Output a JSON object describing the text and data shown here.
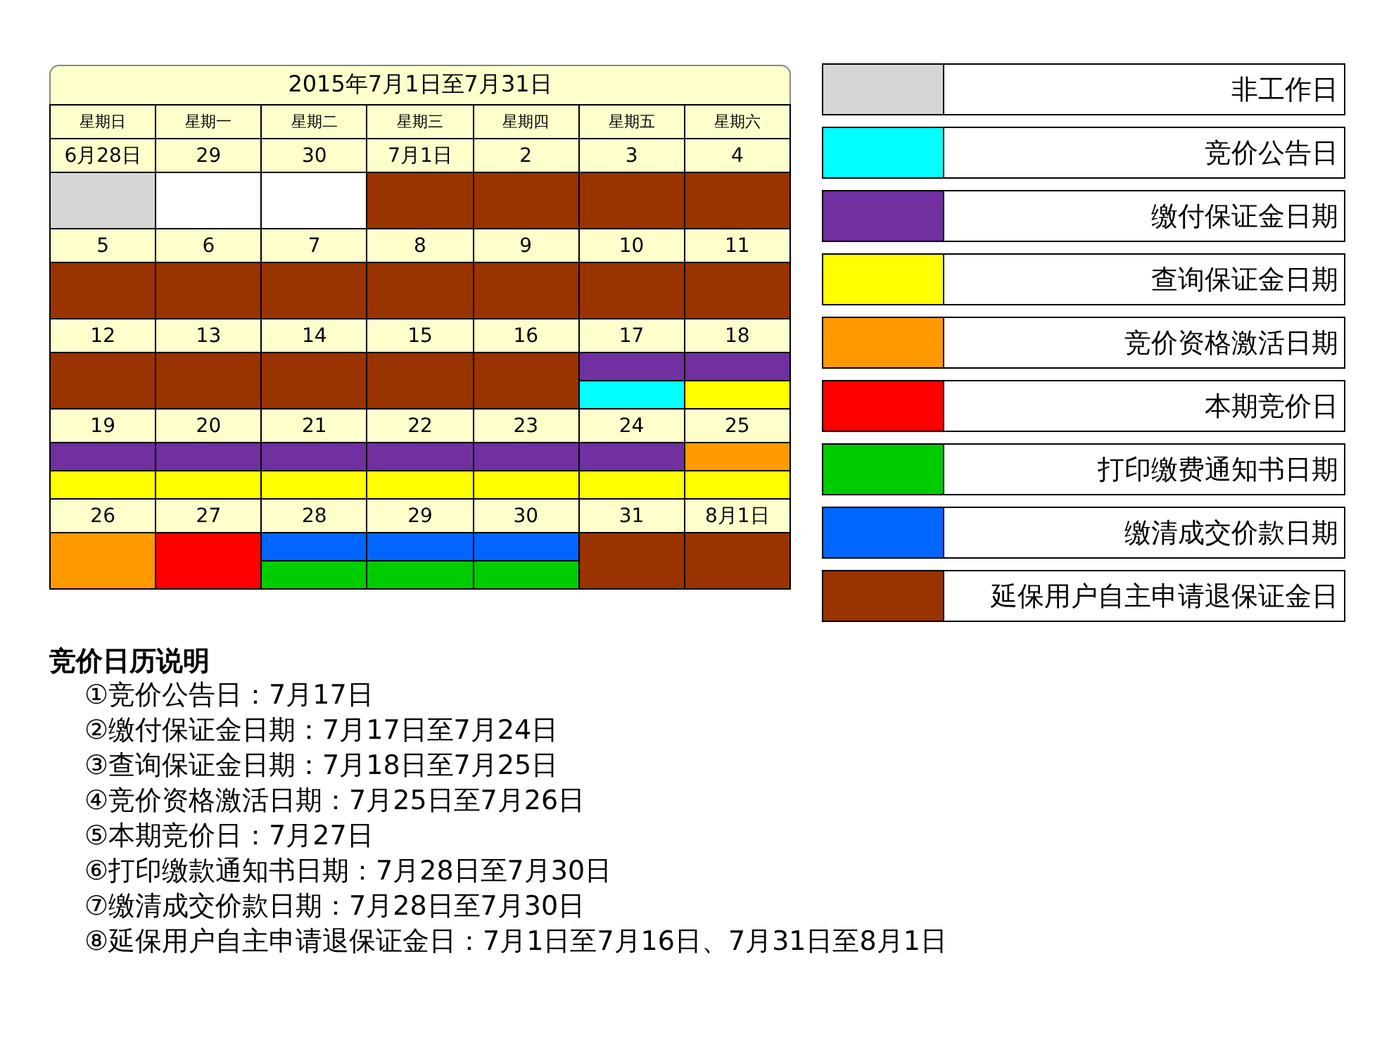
{
  "calendar": {
    "title": "2015年7月1日至7月31日",
    "weekdays": [
      "星期日",
      "星期一",
      "星期二",
      "星期三",
      "星期四",
      "星期五",
      "星期六"
    ],
    "weeks": [
      {
        "days": [
          {
            "label": "6月28日",
            "bands": [
              {
                "color": "#d6d6d6"
              }
            ]
          },
          {
            "label": "29",
            "bands": [
              {
                "color": "#ffffff"
              }
            ]
          },
          {
            "label": "30",
            "bands": [
              {
                "color": "#ffffff"
              }
            ]
          },
          {
            "label": "7月1日",
            "bands": [
              {
                "color": "#993300"
              }
            ]
          },
          {
            "label": "2",
            "bands": [
              {
                "color": "#993300"
              }
            ]
          },
          {
            "label": "3",
            "bands": [
              {
                "color": "#993300"
              }
            ]
          },
          {
            "label": "4",
            "bands": [
              {
                "color": "#993300"
              }
            ]
          }
        ]
      },
      {
        "days": [
          {
            "label": "5",
            "bands": [
              {
                "color": "#993300"
              }
            ]
          },
          {
            "label": "6",
            "bands": [
              {
                "color": "#993300"
              }
            ]
          },
          {
            "label": "7",
            "bands": [
              {
                "color": "#993300"
              }
            ]
          },
          {
            "label": "8",
            "bands": [
              {
                "color": "#993300"
              }
            ]
          },
          {
            "label": "9",
            "bands": [
              {
                "color": "#993300"
              }
            ]
          },
          {
            "label": "10",
            "bands": [
              {
                "color": "#993300"
              }
            ]
          },
          {
            "label": "11",
            "bands": [
              {
                "color": "#993300"
              }
            ]
          }
        ]
      },
      {
        "days": [
          {
            "label": "12",
            "bands": [
              {
                "color": "#993300"
              }
            ]
          },
          {
            "label": "13",
            "bands": [
              {
                "color": "#993300"
              }
            ]
          },
          {
            "label": "14",
            "bands": [
              {
                "color": "#993300"
              }
            ]
          },
          {
            "label": "15",
            "bands": [
              {
                "color": "#993300"
              }
            ]
          },
          {
            "label": "16",
            "bands": [
              {
                "color": "#993300"
              }
            ]
          },
          {
            "label": "17",
            "bands": [
              {
                "color": "#7030a0"
              },
              {
                "color": "#00ffff"
              }
            ]
          },
          {
            "label": "18",
            "bands": [
              {
                "color": "#7030a0"
              },
              {
                "color": "#ffff00"
              }
            ]
          }
        ]
      },
      {
        "days": [
          {
            "label": "19",
            "bands": [
              {
                "color": "#7030a0"
              },
              {
                "color": "#ffff00"
              }
            ]
          },
          {
            "label": "20",
            "bands": [
              {
                "color": "#7030a0"
              },
              {
                "color": "#ffff00"
              }
            ]
          },
          {
            "label": "21",
            "bands": [
              {
                "color": "#7030a0"
              },
              {
                "color": "#ffff00"
              }
            ]
          },
          {
            "label": "22",
            "bands": [
              {
                "color": "#7030a0"
              },
              {
                "color": "#ffff00"
              }
            ]
          },
          {
            "label": "23",
            "bands": [
              {
                "color": "#7030a0"
              },
              {
                "color": "#ffff00"
              }
            ]
          },
          {
            "label": "24",
            "bands": [
              {
                "color": "#7030a0"
              },
              {
                "color": "#ffff00"
              }
            ]
          },
          {
            "label": "25",
            "bands": [
              {
                "color": "#ff9900"
              },
              {
                "color": "#ffff00"
              }
            ]
          }
        ]
      },
      {
        "days": [
          {
            "label": "26",
            "bands": [
              {
                "color": "#ff9900"
              }
            ]
          },
          {
            "label": "27",
            "bands": [
              {
                "color": "#ff0000"
              }
            ]
          },
          {
            "label": "28",
            "bands": [
              {
                "color": "#0066ff"
              },
              {
                "color": "#00cc00"
              }
            ]
          },
          {
            "label": "29",
            "bands": [
              {
                "color": "#0066ff"
              },
              {
                "color": "#00cc00"
              }
            ]
          },
          {
            "label": "30",
            "bands": [
              {
                "color": "#0066ff"
              },
              {
                "color": "#00cc00"
              }
            ]
          },
          {
            "label": "31",
            "bands": [
              {
                "color": "#993300"
              }
            ]
          },
          {
            "label": "8月1日",
            "bands": [
              {
                "color": "#993300"
              }
            ]
          }
        ]
      }
    ]
  },
  "legend": [
    {
      "label": "非工作日",
      "color": "#d6d6d6"
    },
    {
      "label": "竞价公告日",
      "color": "#00ffff"
    },
    {
      "label": "缴付保证金日期",
      "color": "#7030a0"
    },
    {
      "label": "查询保证金日期",
      "color": "#ffff00"
    },
    {
      "label": "竞价资格激活日期",
      "color": "#ff9900"
    },
    {
      "label": "本期竞价日",
      "color": "#ff0000"
    },
    {
      "label": "打印缴费通知书日期",
      "color": "#00cc00"
    },
    {
      "label": "缴清成交价款日期",
      "color": "#0066ff"
    },
    {
      "label": "延保用户自主申请退保证金日",
      "color": "#993300"
    }
  ],
  "notes": {
    "title": "竞价日历说明",
    "items": [
      "①竞价公告日：7月17日",
      "②缴付保证金日期：7月17日至7月24日",
      "③查询保证金日期：7月18日至7月25日",
      "④竞价资格激活日期：7月25日至7月26日",
      "⑤本期竞价日：7月27日",
      "⑥打印缴款通知书日期：7月28日至7月30日",
      "⑦缴清成交价款日期：7月28日至7月30日",
      "⑧延保用户自主申请退保证金日：7月1日至7月16日、7月31日至8月1日"
    ]
  }
}
